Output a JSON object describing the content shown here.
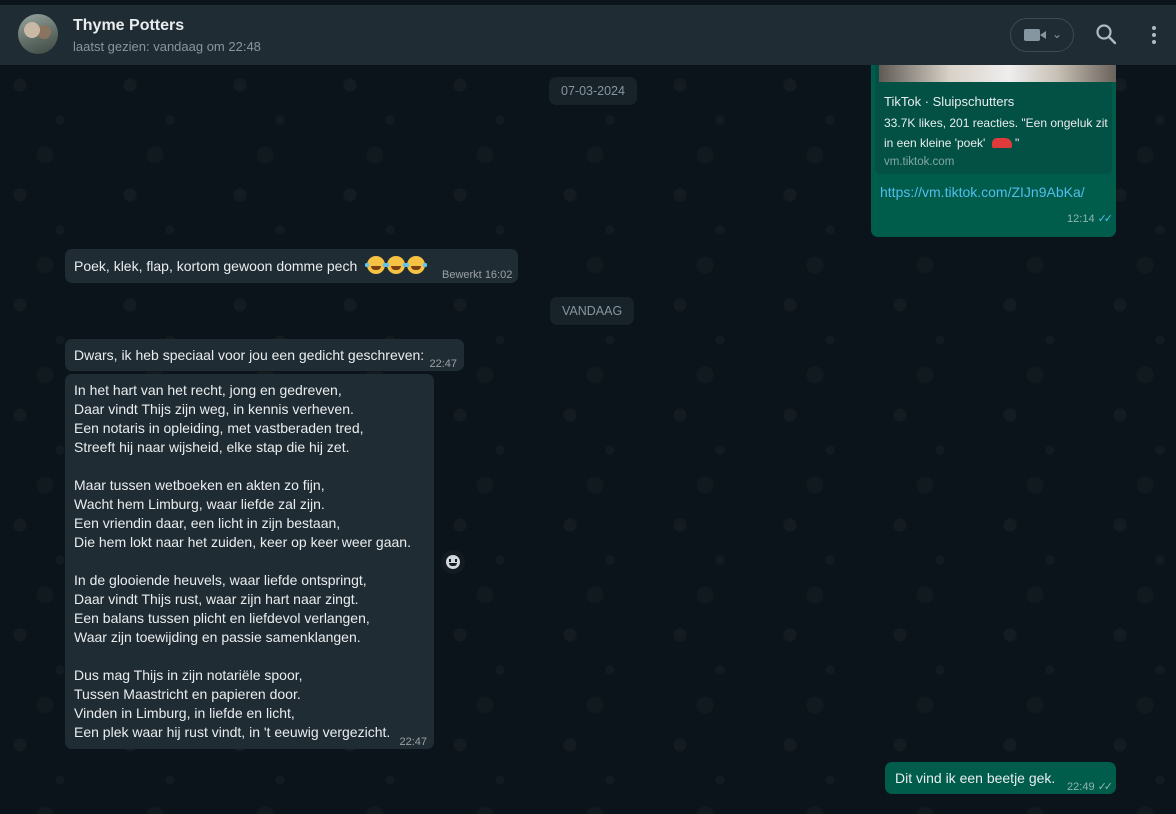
{
  "header": {
    "contact_name": "Thyme Potters",
    "status": "laatst gezien: vandaag om 22:48",
    "icons": [
      "video-call-icon",
      "chevron-down-icon",
      "search-icon",
      "menu-icon"
    ]
  },
  "date_chips": [
    "07-03-2024",
    "VANDAAG"
  ],
  "link_message": {
    "preview_title": "TikTok · Sluipschutters",
    "preview_desc_1": "33.7K likes, 201 reacties. \"Een ongeluk zit",
    "preview_desc_2": "in een kleine 'poek'",
    "preview_desc_end": "\"",
    "preview_domain": "vm.tiktok.com",
    "url": "https://vm.tiktok.com/ZIJn9AbKa/",
    "time": "12:14"
  },
  "msg_poek": {
    "text": "Poek, klek, flap, kortom gewoon domme pech",
    "edited": "Bewerkt",
    "time": "16:02"
  },
  "msg_dwars": {
    "text": "Dwars, ik heb speciaal voor jou een gedicht geschreven:",
    "time": "22:47"
  },
  "poem": {
    "lines": [
      "In het hart van het recht, jong en gedreven,",
      "Daar vindt Thijs zijn weg, in kennis verheven.",
      "Een notaris in opleiding, met vastberaden tred,",
      "Streeft hij naar wijsheid, elke stap die hij zet.",
      "",
      "Maar tussen wetboeken en akten zo fijn,",
      "Wacht hem Limburg, waar liefde zal zijn.",
      "Een vriendin daar, een licht in zijn bestaan,",
      "Die hem lokt naar het zuiden, keer op keer weer gaan.",
      "",
      "In de glooiende heuvels, waar liefde ontspringt,",
      "Daar vindt Thijs rust, waar zijn hart naar zingt.",
      "Een balans tussen plicht en liefdevol verlangen,",
      "Waar zijn toewijding en passie samenklangen.",
      "",
      "Dus mag Thijs in zijn notariële spoor,",
      "Tussen Maastricht en papieren door.",
      "Vinden in Limburg, in liefde en licht,",
      "Een plek waar hij rust vindt, in 't eeuwig vergezicht."
    ],
    "time": "22:47"
  },
  "msg_gek": {
    "text": "Dit vind ik een beetje gek.",
    "time": "22:49"
  },
  "colors": {
    "background": "#0b141a",
    "header": "#202c33",
    "incoming": "#202c33",
    "outgoing": "#005c4b",
    "link": "#53bdeb"
  }
}
